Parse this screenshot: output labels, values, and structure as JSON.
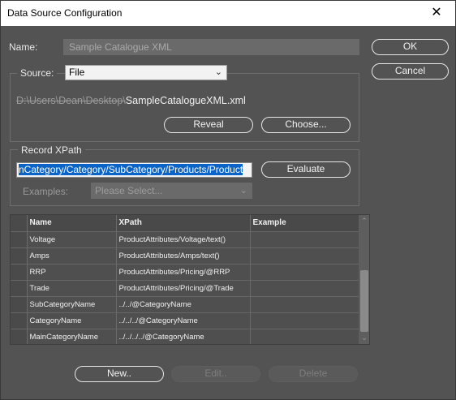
{
  "window": {
    "title": "Data Source Configuration",
    "close_glyph": "✕"
  },
  "name": {
    "label": "Name:",
    "value": "Sample Catalogue XML"
  },
  "buttons": {
    "ok": "OK",
    "cancel": "Cancel",
    "reveal": "Reveal",
    "choose": "Choose...",
    "evaluate": "Evaluate",
    "new": "New..",
    "edit": "Edit..",
    "delete": "Delete"
  },
  "source": {
    "label": "Source:",
    "selected": "File",
    "path_hidden": "D:\\Users\\Dean\\Desktop\\",
    "path_file": "SampleCatalogueXML.xml"
  },
  "record_xpath": {
    "label": "Record XPath",
    "value": "nCategory/Category/SubCategory/Products/Product",
    "examples_label": "Examples:",
    "examples_placeholder": "Please Select..."
  },
  "table": {
    "columns": [
      "Name",
      "XPath",
      "Example"
    ],
    "rows": [
      {
        "name": "Voltage",
        "xpath": "ProductAttributes/Voltage/text()",
        "example": ""
      },
      {
        "name": "Amps",
        "xpath": "ProductAttributes/Amps/text()",
        "example": ""
      },
      {
        "name": "RRP",
        "xpath": "ProductAttributes/Pricing/@RRP",
        "example": ""
      },
      {
        "name": "Trade",
        "xpath": "ProductAttributes/Pricing/@Trade",
        "example": ""
      },
      {
        "name": "SubCategoryName",
        "xpath": "../../@CategoryName",
        "example": ""
      },
      {
        "name": "CategoryName",
        "xpath": "../../../@CategoryName",
        "example": ""
      },
      {
        "name": "MainCategoryName",
        "xpath": "../../../../@CategoryName",
        "example": ""
      }
    ]
  }
}
